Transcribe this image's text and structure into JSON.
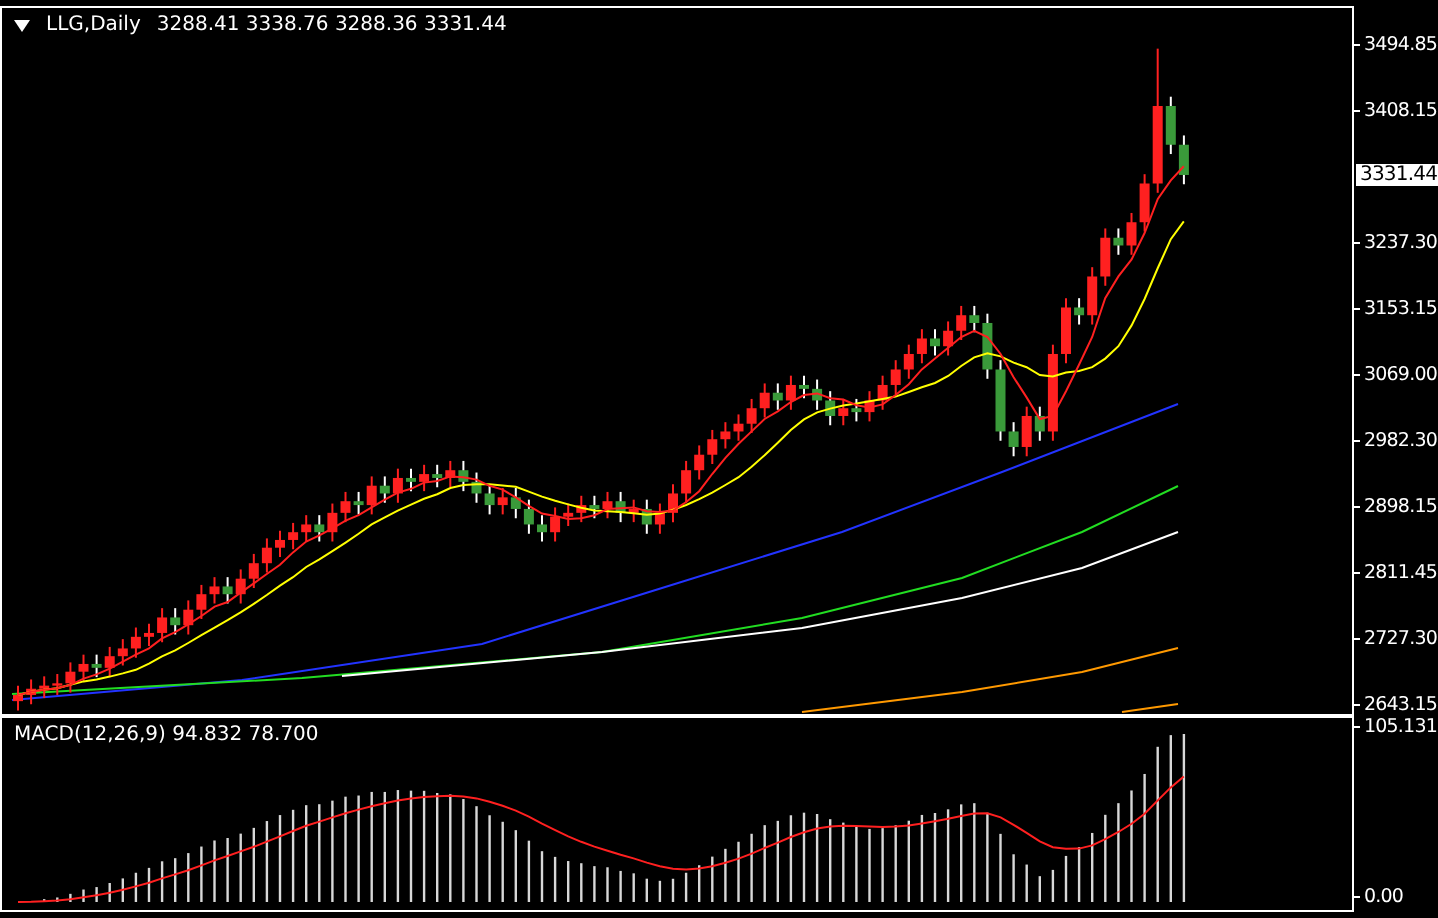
{
  "chart": {
    "symbol": "LLG,Daily",
    "ohlc": [
      "3288.41",
      "3338.76",
      "3288.36",
      "3331.44"
    ],
    "price_axis": [
      "3494.85",
      "3408.15",
      "3237.30",
      "3153.15",
      "3069.00",
      "2982.30",
      "2898.15",
      "2811.45",
      "2727.30",
      "2643.15"
    ],
    "current_price": "3331.44"
  },
  "macd": {
    "label": "MACD(12,26,9) 94.832 78.700",
    "axis": [
      "105.131",
      "0.00"
    ]
  }
}
